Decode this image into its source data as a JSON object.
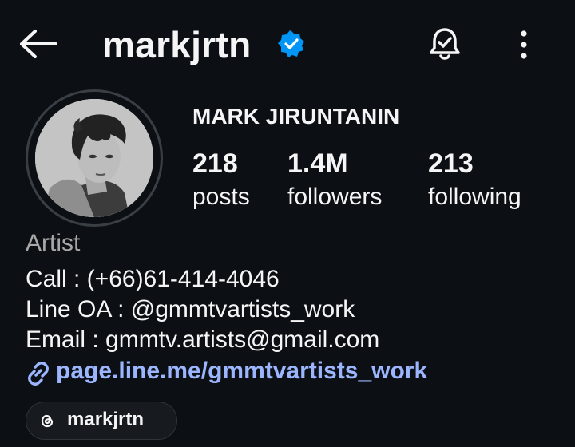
{
  "header": {
    "username": "markjrtn"
  },
  "profile": {
    "full_name": "MARK JIRUNTANIN",
    "stats": [
      {
        "value": "218",
        "label": "posts"
      },
      {
        "value": "1.4M",
        "label": "followers"
      },
      {
        "value": "213",
        "label": "following"
      }
    ],
    "category": "Artist",
    "bio": [
      "Call : (+66)61-414-4046",
      "Line OA : @gmmtvartists_work",
      "Email : gmmtv.artists@gmail.com"
    ],
    "link": "page.line.me/gmmtvartists_work",
    "threads_handle": "markjrtn"
  },
  "icons": {
    "back": "back-arrow-icon",
    "verified": "verified-badge-icon",
    "notifications": "bell-icon",
    "more": "more-options-icon",
    "link": "link-icon",
    "threads": "threads-icon"
  },
  "colors": {
    "background": "#0c1014",
    "text": "#f5f5f5",
    "muted": "#a8a8a8",
    "link": "#9bb5ff",
    "verified": "#0095f6"
  }
}
